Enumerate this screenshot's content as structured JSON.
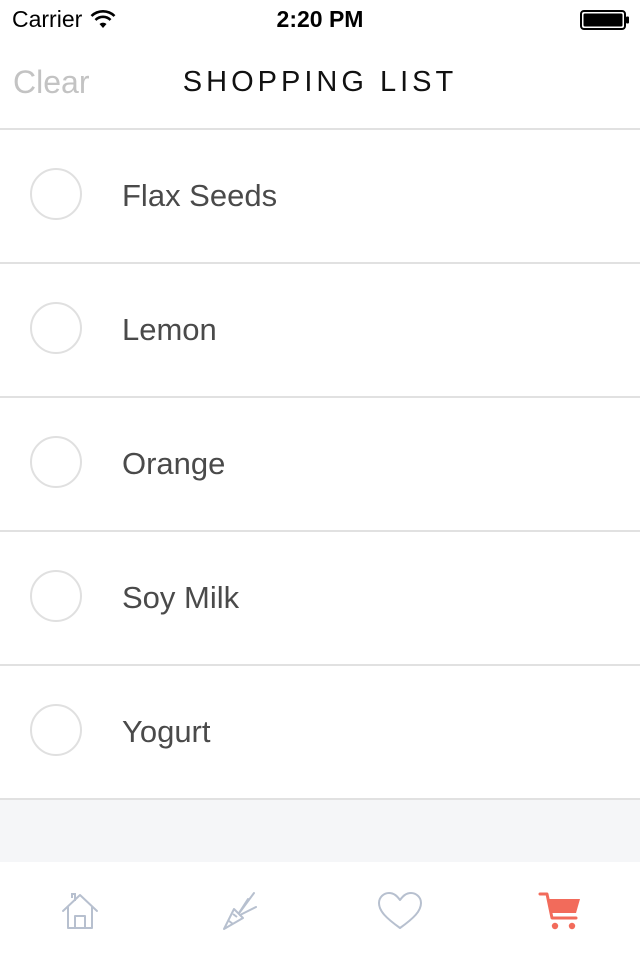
{
  "status_bar": {
    "carrier": "Carrier",
    "time": "2:20 PM"
  },
  "nav": {
    "clear_label": "Clear",
    "title": "SHOPPING LIST"
  },
  "items": [
    {
      "label": "Flax Seeds",
      "checked": false
    },
    {
      "label": "Lemon",
      "checked": false
    },
    {
      "label": "Orange",
      "checked": false
    },
    {
      "label": "Soy Milk",
      "checked": false
    },
    {
      "label": "Yogurt",
      "checked": false
    }
  ],
  "tabs": [
    {
      "icon": "home-icon",
      "active": false
    },
    {
      "icon": "carrot-icon",
      "active": false
    },
    {
      "icon": "heart-icon",
      "active": false
    },
    {
      "icon": "cart-icon",
      "active": true
    }
  ],
  "colors": {
    "active_tab": "#f26b5b",
    "inactive_tab": "#b7c0cf",
    "divider": "#e1e1e1",
    "clear_text": "#c3c3c3",
    "item_text": "#4a4a4a",
    "empty_bg": "#f5f6f8"
  }
}
